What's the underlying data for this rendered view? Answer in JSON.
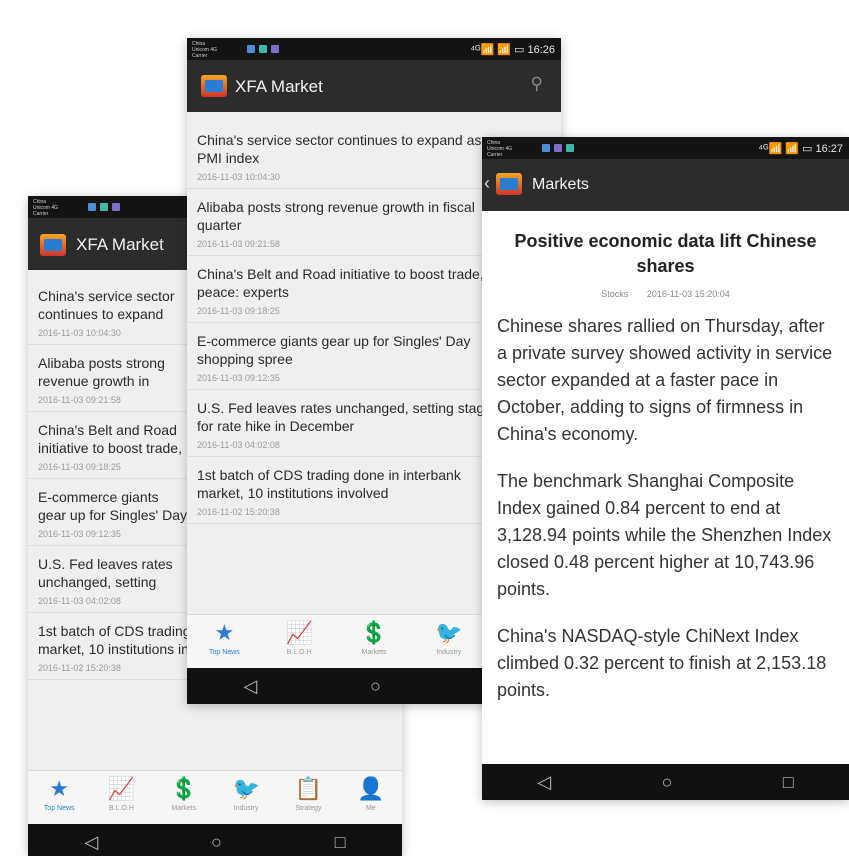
{
  "statusbar": {
    "carrier": "China Unicom 4G Carrier",
    "time_a": "16:26",
    "time_c": "16:27",
    "signal": "⁴ᴳ📶 📶 ▭"
  },
  "app": {
    "title": "XFA Market",
    "markets_title": "Markets"
  },
  "news": [
    {
      "headline": "China's service sector continues to expand as PMI index",
      "time": "2016-11-03 10:04:30"
    },
    {
      "headline": "Alibaba posts strong revenue growth in fiscal quarter",
      "time": "2016-11-03 09:21:58"
    },
    {
      "headline": "China's Belt and Road initiative to boost trade, peace: experts",
      "time": "2016-11-03 09:18:25"
    },
    {
      "headline": "E-commerce giants gear up for Singles' Day shopping spree",
      "time": "2016-11-03 09:12:35"
    },
    {
      "headline": "U.S. Fed leaves rates unchanged, setting stage for rate hike in December",
      "time": "2016-11-03 04:02:08"
    },
    {
      "headline": "1st batch of CDS trading done in interbank market, 10 institutions involved",
      "time": "2016-11-02 15:20:38"
    }
  ],
  "tabs": [
    {
      "label": "Top News",
      "icon": "★"
    },
    {
      "label": "B.L.O.H",
      "icon": "📈"
    },
    {
      "label": "Markets",
      "icon": "💲"
    },
    {
      "label": "Industry",
      "icon": "🐦"
    },
    {
      "label": "Strategy",
      "icon": "📋"
    },
    {
      "label": "Me",
      "icon": "👤"
    }
  ],
  "navbar": {
    "back": "◁",
    "home": "○",
    "recent": "□"
  },
  "article": {
    "title": "Positive economic data lift Chinese shares",
    "category": "Stocks",
    "time": "2016-11-03 15:20:04",
    "paragraphs": [
      "Chinese shares rallied on Thursday, after a private survey showed activity in service sector expanded at a faster pace in October, adding to signs of firmness in China's economy.",
      "The benchmark Shanghai Composite Index gained 0.84 percent to end at 3,128.94 points while the Shenzhen Index closed 0.48 percent higher at 10,743.96 points.",
      "China's NASDAQ-style ChiNext Index climbed 0.32 percent to finish at 2,153.18 points."
    ]
  },
  "colors": {
    "accent": "#2b7cd3",
    "bar": "#2c2c2c",
    "status": "#141414"
  }
}
